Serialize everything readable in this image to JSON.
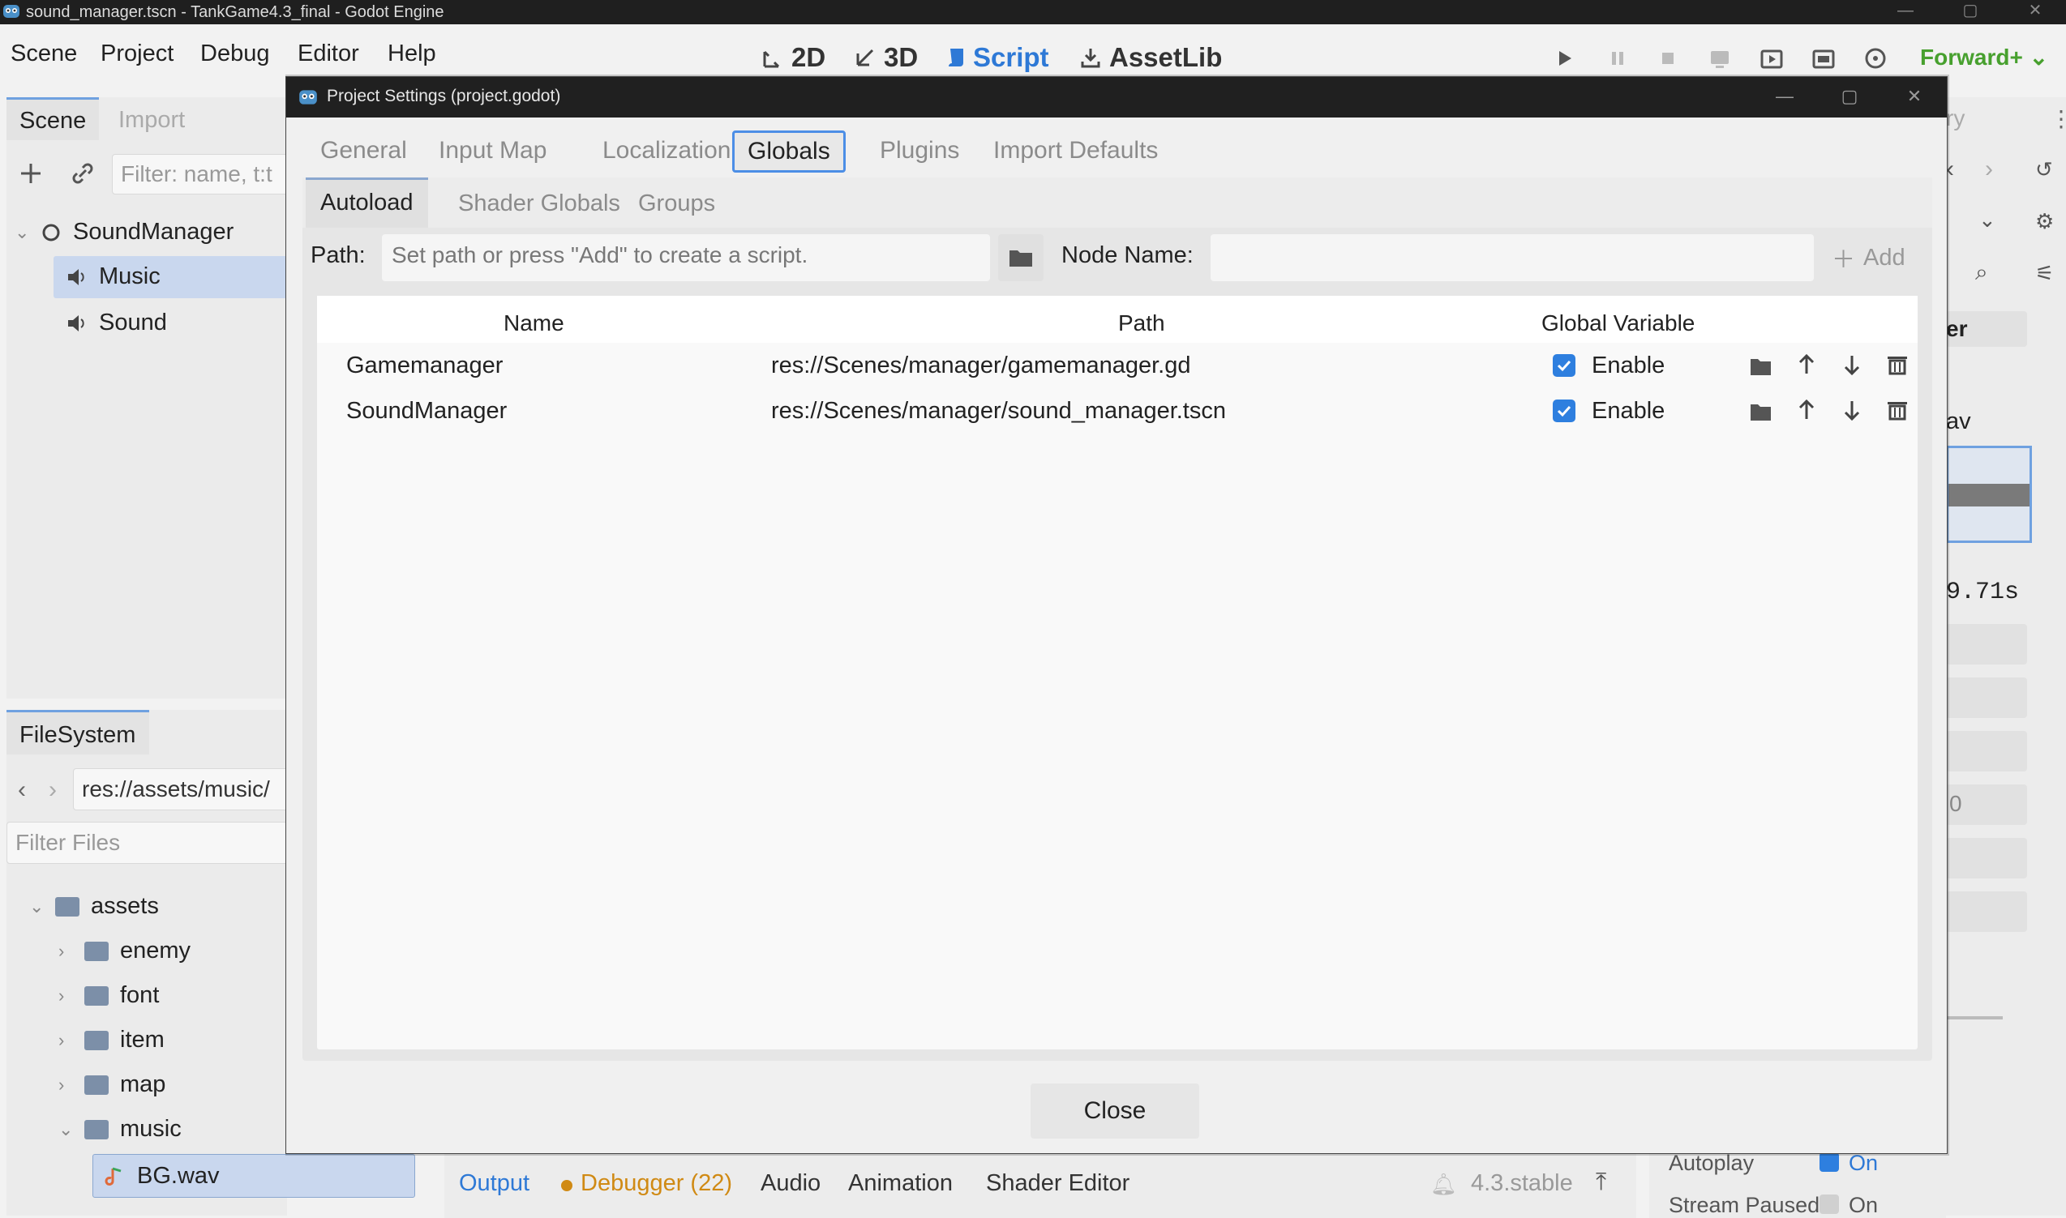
{
  "window": {
    "title": "sound_manager.tscn - TankGame4.3_final - Godot Engine",
    "controls": [
      "—",
      "▢",
      "✕"
    ]
  },
  "menu": {
    "items": [
      "Scene",
      "Project",
      "Debug",
      "Editor",
      "Help"
    ]
  },
  "workspaces": {
    "tabs": [
      {
        "label": "2D",
        "active": false
      },
      {
        "label": "3D",
        "active": false
      },
      {
        "label": "Script",
        "active": true
      },
      {
        "label": "AssetLib",
        "active": false
      }
    ]
  },
  "renderer": {
    "label": "Forward+"
  },
  "scene_panel": {
    "tabs": [
      "Scene",
      "Import"
    ],
    "filter_placeholder": "Filter: name, t:t",
    "tree": [
      {
        "label": "SoundManager",
        "level": 0
      },
      {
        "label": "Music",
        "level": 1,
        "selected": true
      },
      {
        "label": "Sound",
        "level": 1
      }
    ]
  },
  "filesystem_panel": {
    "tab": "FileSystem",
    "path": "res://assets/music/",
    "filter_placeholder": "Filter Files",
    "tree": [
      {
        "label": "assets",
        "level": 0,
        "expanded": true
      },
      {
        "label": "enemy",
        "level": 1
      },
      {
        "label": "font",
        "level": 1
      },
      {
        "label": "item",
        "level": 1
      },
      {
        "label": "map",
        "level": 1
      },
      {
        "label": "music",
        "level": 1,
        "expanded": true
      },
      {
        "label": "BG.wav",
        "level": 2,
        "selected": true
      }
    ]
  },
  "inspector_fragments": {
    "title_fragment": "er",
    "tab_fragment": "ry",
    "file_fragment": "av",
    "duration_fragment": "9.71s",
    "number_fragment": "0",
    "autoplay_label": "Autoplay",
    "autoplay_value": "On",
    "stream_paused_label": "Stream Paused",
    "stream_paused_value": "On"
  },
  "bottom_panel": {
    "tabs": [
      {
        "label": "Output",
        "active": true
      },
      {
        "label": "Debugger (22)",
        "warning": true
      },
      {
        "label": "Audio"
      },
      {
        "label": "Animation"
      },
      {
        "label": "Shader Editor"
      }
    ],
    "version": "4.3.stable"
  },
  "dialog": {
    "title": "Project Settings (project.godot)",
    "tabs": [
      {
        "label": "General",
        "active": false
      },
      {
        "label": "Input Map",
        "active": false
      },
      {
        "label": "Localization",
        "active": false
      },
      {
        "label": "Globals",
        "active": true
      },
      {
        "label": "Plugins",
        "active": false
      },
      {
        "label": "Import Defaults",
        "active": false
      }
    ],
    "subtabs": [
      {
        "label": "Autoload",
        "active": true
      },
      {
        "label": "Shader Globals",
        "active": false
      },
      {
        "label": "Groups",
        "active": false
      }
    ],
    "path_label": "Path:",
    "path_placeholder": "Set path or press \"Add\" to create a script.",
    "node_name_label": "Node Name:",
    "node_name_value": "",
    "add_label": "Add",
    "columns": [
      "Name",
      "Path",
      "Global Variable"
    ],
    "rows": [
      {
        "name": "Gamemanager",
        "path": "res://Scenes/manager/gamemanager.gd",
        "enabled": true,
        "enable_label": "Enable"
      },
      {
        "name": "SoundManager",
        "path": "res://Scenes/manager/sound_manager.tscn",
        "enabled": true,
        "enable_label": "Enable"
      }
    ],
    "close_label": "Close"
  },
  "colors": {
    "accent": "#2e79d6",
    "renderer": "#47a02e",
    "warning": "#d08a14",
    "checkbox": "#2e7fdf"
  }
}
